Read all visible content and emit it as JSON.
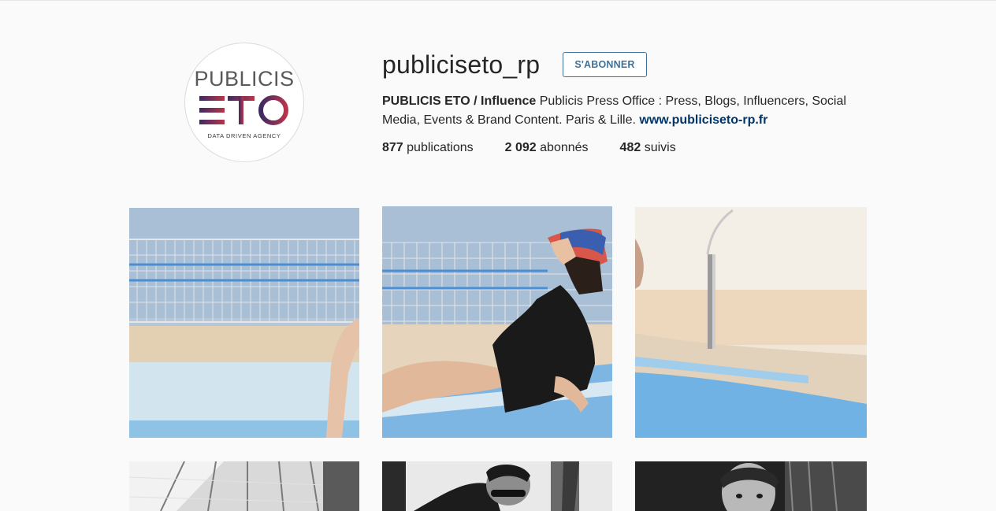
{
  "profile": {
    "username": "publiciseto_rp",
    "follow_label": "S'ABONNER",
    "logo": {
      "wordmark": "PUBLICIS",
      "brand": "ETO",
      "tagline": "DATA DRIVEN AGENCY"
    },
    "bio": {
      "name": "PUBLICIS ETO / Influence",
      "text": " Publicis Press Office : Press, Blogs, Influencers, Social Media, Events & Brand Content. Paris & Lille. ",
      "link": "www.publiciseto-rp.fr"
    },
    "stats": [
      {
        "count": "877",
        "label": " publications"
      },
      {
        "count": "2 092",
        "label": " abonnés"
      },
      {
        "count": "482",
        "label": " suivis"
      }
    ]
  },
  "colors": {
    "accent": "#3f729b",
    "link": "#003569",
    "brand_gradient_start": "#3d2a63",
    "brand_gradient_end": "#b8354a"
  },
  "posts": [
    {
      "id": "post-1",
      "icon": "photo"
    },
    {
      "id": "post-2",
      "icon": "photo"
    },
    {
      "id": "post-3",
      "icon": "photo"
    },
    {
      "id": "post-4",
      "icon": "photo"
    },
    {
      "id": "post-5",
      "icon": "photo"
    },
    {
      "id": "post-6",
      "icon": "photo"
    }
  ]
}
